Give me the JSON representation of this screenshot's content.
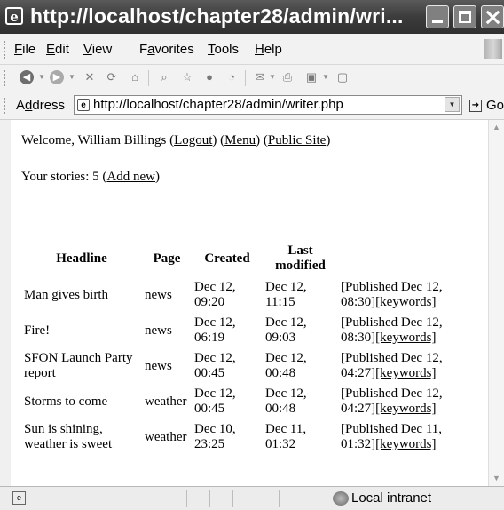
{
  "window": {
    "title": "http://localhost/chapter28/admin/wri..."
  },
  "menubar": {
    "items": [
      {
        "key": "F",
        "rest": "ile"
      },
      {
        "key": "E",
        "rest": "dit"
      },
      {
        "key": "V",
        "rest": "iew"
      },
      {
        "pre": "F",
        "key": "a",
        "rest": "vorites"
      },
      {
        "key": "T",
        "rest": "ools"
      },
      {
        "key": "H",
        "rest": "elp"
      }
    ]
  },
  "address": {
    "label_key": "d",
    "label_pre": "A",
    "label_rest": "dress",
    "url": "http://localhost/chapter28/admin/writer.php",
    "go_label": "Go"
  },
  "page": {
    "welcome_prefix": "Welcome, William Billings ",
    "logout_link": "Logout",
    "menu_link": "Menu",
    "public_site_link": "Public Site",
    "stories_prefix": "Your stories: 5 ",
    "add_new_link": "Add new"
  },
  "table": {
    "headers": [
      "Headline",
      "Page",
      "Created",
      "Last modified"
    ],
    "rows": [
      {
        "headline": "Man gives birth",
        "page": "news",
        "created": "Dec 12, 09:20",
        "modified": "Dec 12, 11:15",
        "status": "[Published Dec 12, 08:30]",
        "keywords": "[keywords]"
      },
      {
        "headline": "Fire!",
        "page": "news",
        "created": "Dec 12, 06:19",
        "modified": "Dec 12, 09:03",
        "status": "[Published Dec 12, 08:30]",
        "keywords": "[keywords]"
      },
      {
        "headline": "SFON Launch Party report",
        "page": "news",
        "created": "Dec 12, 00:45",
        "modified": "Dec 12, 00:48",
        "status": "[Published Dec 12, 04:27]",
        "keywords": "[keywords]"
      },
      {
        "headline": "Storms to come",
        "page": "weather",
        "created": "Dec 12, 00:45",
        "modified": "Dec 12, 00:48",
        "status": "[Published Dec 12, 04:27]",
        "keywords": "[keywords]"
      },
      {
        "headline": "Sun is shining, weather is sweet",
        "page": "weather",
        "created": "Dec 10, 23:25",
        "modified": "Dec 11, 01:32",
        "status": "[Published Dec 11, 01:32]",
        "keywords": "[keywords]"
      }
    ]
  },
  "statusbar": {
    "zone": "Local intranet"
  },
  "icons": {
    "ie": "internet-explorer-icon",
    "back": "back-icon",
    "forward": "forward-icon",
    "stop": "stop-icon",
    "refresh": "refresh-icon",
    "home": "home-icon",
    "search": "search-icon",
    "favorites": "favorites-star-icon",
    "media": "media-icon",
    "history": "history-icon",
    "mail": "mail-icon",
    "print": "print-icon",
    "edit": "edit-icon",
    "discuss": "discuss-icon"
  }
}
